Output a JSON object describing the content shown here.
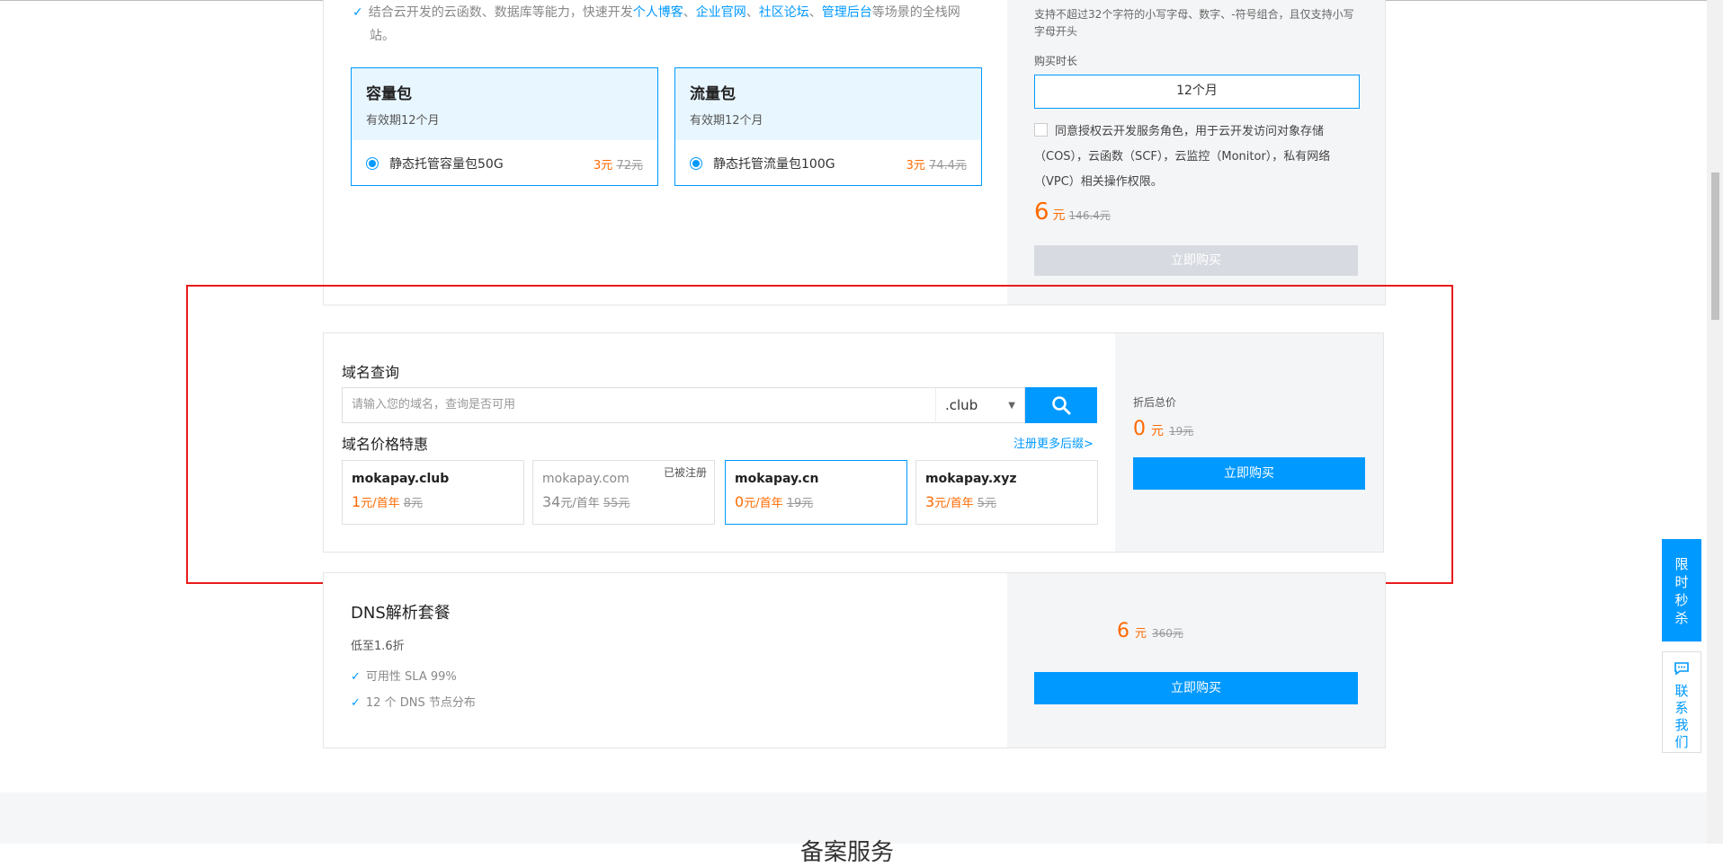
{
  "top_product": {
    "desc_prefix": "结合云开发的云函数、数据库等能力，快速开发",
    "desc_links": [
      "个人博客",
      "企业官网",
      "社区论坛",
      "管理后台"
    ],
    "desc_suffix": "等场景的全栈网",
    "desc_line2": "站。",
    "packs": [
      {
        "title": "容量包",
        "validity": "有效期12个月",
        "option": "静态托管容量包50G",
        "price": "3元",
        "old_price": "72元"
      },
      {
        "title": "流量包",
        "validity": "有效期12个月",
        "option": "静态托管流量包100G",
        "price": "3元",
        "old_price": "74.4元"
      }
    ],
    "side": {
      "hint": "支持不超过32个字符的小写字母、数字、-符号组合，且仅支持小写字母开头",
      "duration_label": "购买时长",
      "duration_value": "12个月",
      "agree_text": "同意授权云开发服务角色，用于云开发访问对象存储（COS），云函数（SCF），云监控（Monitor），私有网络（VPC）相关操作权限。",
      "total": "6",
      "unit": "元",
      "old_total": "146.4元",
      "buy_label": "立即购买"
    }
  },
  "domain": {
    "title": "域名查询",
    "search_placeholder": "请输入您的域名，查询是否可用",
    "suffix": ".club",
    "price_title": "域名价格特惠",
    "more_link": "注册更多后缀>",
    "items": [
      {
        "name": "mokapay.club",
        "price": "1",
        "unit": "元/首年",
        "old": "8元",
        "tag": ""
      },
      {
        "name": "mokapay.com",
        "price": "34",
        "unit": "元/首年",
        "old": "55元",
        "tag": "已被注册"
      },
      {
        "name": "mokapay.cn",
        "price": "0",
        "unit": "元/首年",
        "old": "19元",
        "tag": ""
      },
      {
        "name": "mokapay.xyz",
        "price": "3",
        "unit": "元/首年",
        "old": "5元",
        "tag": ""
      }
    ],
    "summary_label": "折后总价",
    "total": "0",
    "unit": "元",
    "old_total": "19元",
    "buy_label": "立即购买"
  },
  "dns": {
    "title": "DNS解析套餐",
    "subtitle": "低至1.6折",
    "features": [
      "可用性 SLA 99%",
      "12 个 DNS 节点分布"
    ],
    "price": "6",
    "unit": "元",
    "old_price": "360元",
    "buy_label": "立即购买"
  },
  "bottom": {
    "section_title": "备案服务"
  },
  "floating": {
    "flash_sale": [
      "限",
      "时",
      "秒",
      "杀"
    ],
    "contact": [
      "联",
      "系",
      "我",
      "们"
    ]
  },
  "colors": {
    "accent": "#0099ff",
    "price": "#ff6a00",
    "highlight": "#e81b1b"
  }
}
